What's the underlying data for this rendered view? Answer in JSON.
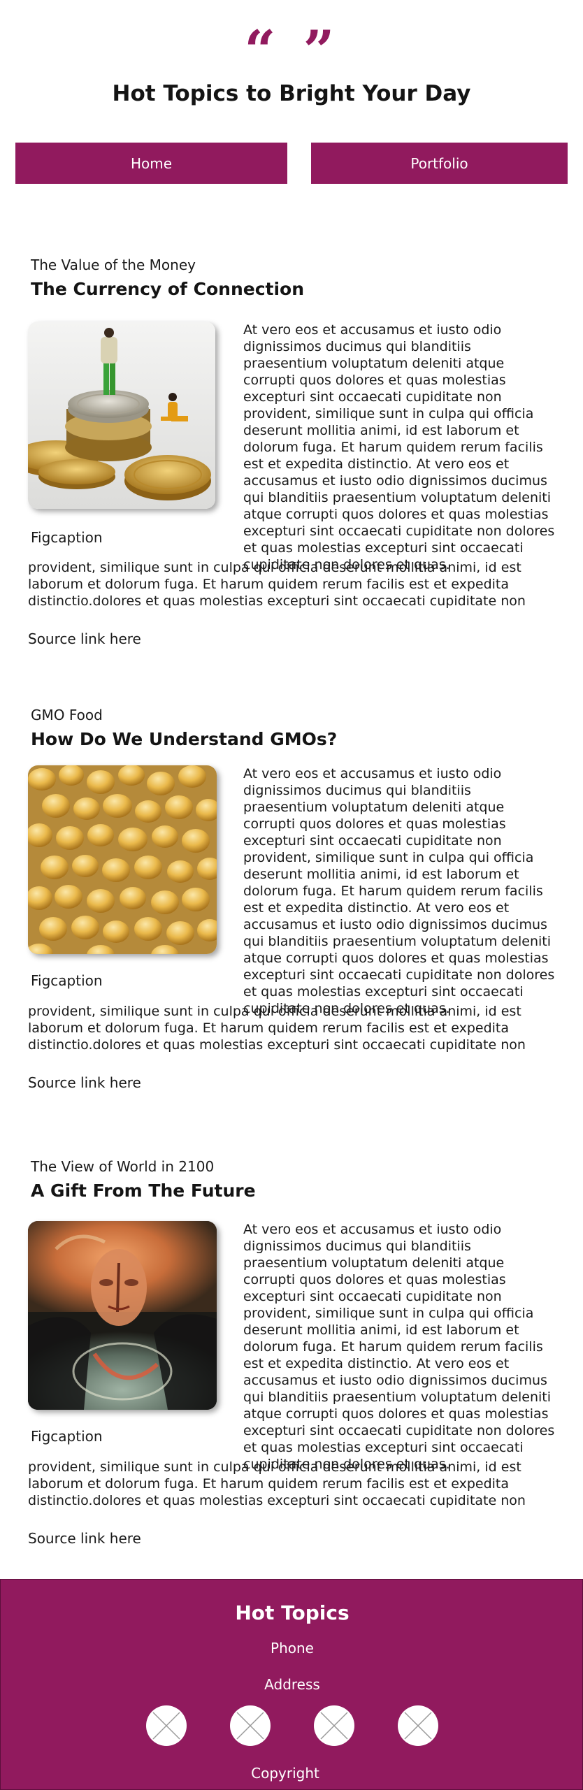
{
  "header": {
    "quote_glyph": "“ ”",
    "title": "Hot Topics to Bright Your Day"
  },
  "nav": {
    "home_label": "Home",
    "portfolio_label": "Portfolio"
  },
  "articles": [
    {
      "kicker": "The Value of the Money",
      "headline": "The Currency of Connection",
      "image_icon": "coins-figurines-image",
      "figcaption": "Figcaption",
      "body_col": "At vero eos et accusamus et iusto odio dignissimos ducimus qui blanditiis praesentium voluptatum deleniti atque corrupti quos dolores et quas molestias excepturi sint occaecati cupiditate non provident, similique sunt in culpa qui officia deserunt mollitia animi, id est laborum et dolorum fuga. Et harum quidem rerum facilis est et expedita distinctio. At vero eos et accusamus et iusto odio dignissimos ducimus qui blanditiis praesentium voluptatum deleniti atque corrupti quos dolores et quas molestias excepturi sint occaecati cupiditate non dolores et quas molestias excepturi sint occaecati cupiditate non dolores et quas.",
      "body_full": "provident, similique sunt in culpa qui officia deserunt mollitia animi, id est laborum et dolorum fuga. Et harum quidem rerum facilis est et expedita distinctio.dolores et quas molestias excepturi sint occaecati cupiditate non",
      "source_link": "Source link here"
    },
    {
      "kicker": "GMO Food",
      "headline": "How Do We Understand GMOs?",
      "image_icon": "corn-kernels-image",
      "figcaption": "Figcaption",
      "body_col": "At vero eos et accusamus et iusto odio dignissimos ducimus qui blanditiis praesentium voluptatum deleniti atque corrupti quos dolores et quas molestias excepturi sint occaecati cupiditate non provident, similique sunt in culpa qui officia deserunt mollitia animi, id est laborum et dolorum fuga. Et harum quidem rerum facilis est et expedita distinctio. At vero eos et accusamus et iusto odio dignissimos ducimus qui blanditiis praesentium voluptatum deleniti atque corrupti quos dolores et quas molestias excepturi sint occaecati cupiditate non dolores et quas molestias excepturi sint occaecati cupiditate non dolores et quas.",
      "body_full": "provident, similique sunt in culpa qui officia deserunt mollitia animi, id est laborum et dolorum fuga. Et harum quidem rerum facilis est et expedita distinctio.dolores et quas molestias excepturi sint occaecati cupiditate non",
      "source_link": "Source link here"
    },
    {
      "kicker": "The View of World in 2100",
      "headline": "A Gift From The Future",
      "image_icon": "abstract-painting-image",
      "figcaption": "Figcaption",
      "body_col": "At vero eos et accusamus et iusto odio dignissimos ducimus qui blanditiis praesentium voluptatum deleniti atque corrupti quos dolores et quas molestias excepturi sint occaecati cupiditate non provident, similique sunt in culpa qui officia deserunt mollitia animi, id est laborum et dolorum fuga. Et harum quidem rerum facilis est et expedita distinctio. At vero eos et accusamus et iusto odio dignissimos ducimus qui blanditiis praesentium voluptatum deleniti atque corrupti quos dolores et quas molestias excepturi sint occaecati cupiditate non dolores et quas molestias excepturi sint occaecati cupiditate non dolores et quas.",
      "body_full": "provident, similique sunt in culpa qui officia deserunt mollitia animi, id est laborum et dolorum fuga. Et harum quidem rerum facilis est et expedita distinctio.dolores et quas molestias excepturi sint occaecati cupiditate non",
      "source_link": "Source link here"
    }
  ],
  "footer": {
    "title": "Hot Topics",
    "phone": "Phone",
    "address": "Address",
    "copyright": "Copyright",
    "social_icons": [
      "image-placeholder-icon",
      "image-placeholder-icon",
      "image-placeholder-icon",
      "image-placeholder-icon"
    ]
  },
  "colors": {
    "accent": "#911a5e",
    "text": "#1a1a1a",
    "background": "#ffffff"
  }
}
